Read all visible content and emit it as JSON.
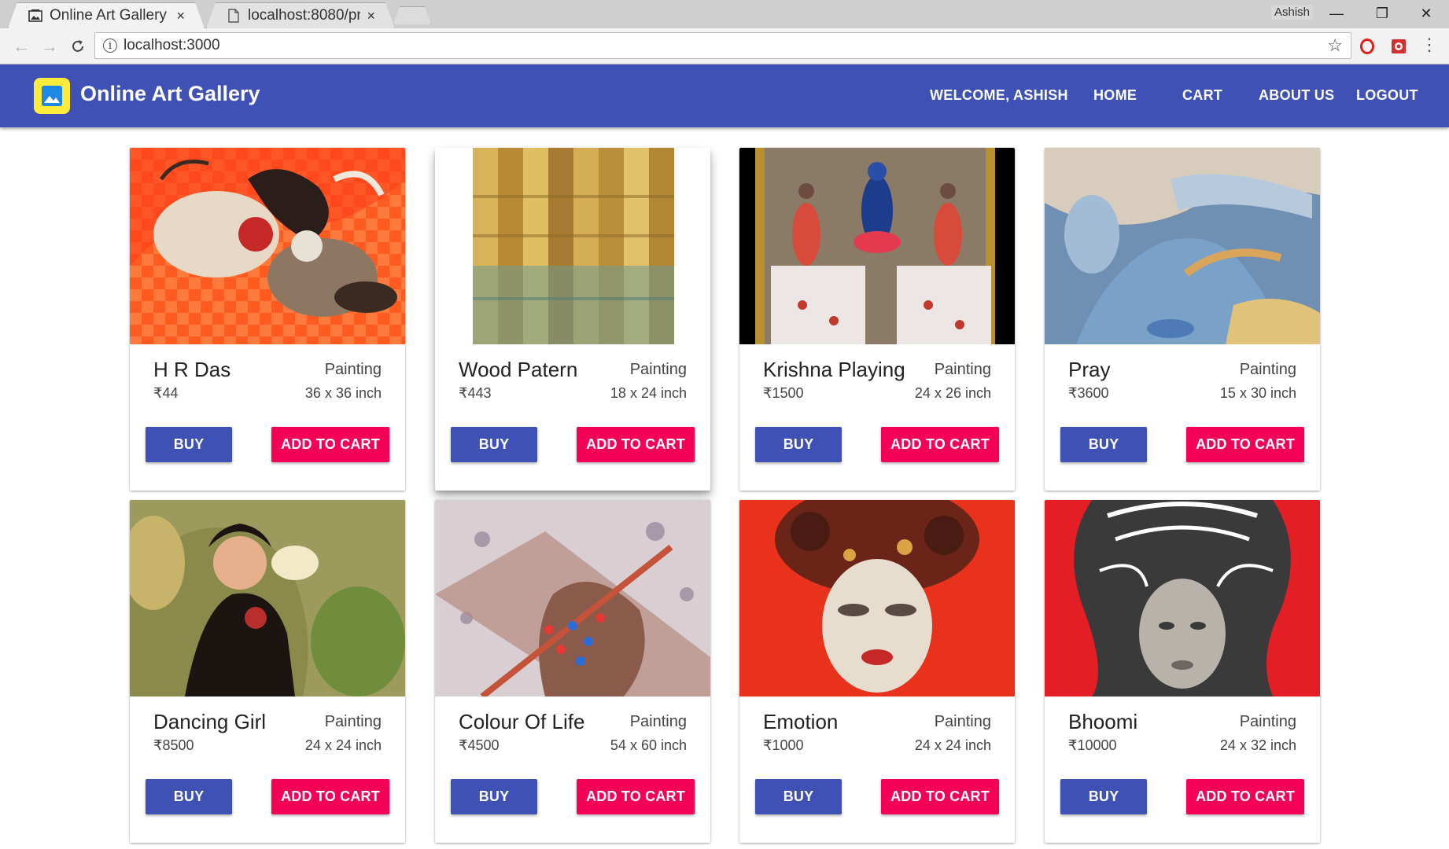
{
  "browser": {
    "tabs": [
      {
        "title": "Online Art Gallery",
        "close": "×"
      },
      {
        "title": "localhost:8080/produ",
        "close": "×"
      }
    ],
    "profile_name": "Ashish",
    "window_controls": {
      "minimize": "—",
      "restore": "❐",
      "close": "✕"
    },
    "url": "localhost:3000"
  },
  "appbar": {
    "brand": "Online Art Gallery",
    "welcome": "WELCOME,  ASHISH",
    "nav": {
      "home": "HOME",
      "cart": "CART",
      "about": "ABOUT US",
      "logout": "LOGOUT"
    }
  },
  "buttons": {
    "buy": "BUY",
    "add_to_cart": "ADD TO CART"
  },
  "products": [
    {
      "name": "H R Das",
      "category": "Painting",
      "price": "₹44",
      "size": "36 x 36 inch"
    },
    {
      "name": "Wood Patern",
      "category": "Painting",
      "price": "₹443",
      "size": "18 x 24 inch"
    },
    {
      "name": "Krishna Playing",
      "category": "Painting",
      "price": "₹1500",
      "size": "24 x 26 inch"
    },
    {
      "name": "Pray",
      "category": "Painting",
      "price": "₹3600",
      "size": "15 x 30 inch"
    },
    {
      "name": "Dancing Girl",
      "category": "Painting",
      "price": "₹8500",
      "size": "24 x 24 inch"
    },
    {
      "name": "Colour Of Life",
      "category": "Painting",
      "price": "₹4500",
      "size": "54 x 60 inch"
    },
    {
      "name": "Emotion",
      "category": "Painting",
      "price": "₹1000",
      "size": "24 x 24 inch"
    },
    {
      "name": "Bhoomi",
      "category": "Painting",
      "price": "₹10000",
      "size": "24 x 32 inch"
    }
  ],
  "colors": {
    "primary": "#3f51b5",
    "accent": "#f50057",
    "logo_bg": "#ffeb3b"
  }
}
